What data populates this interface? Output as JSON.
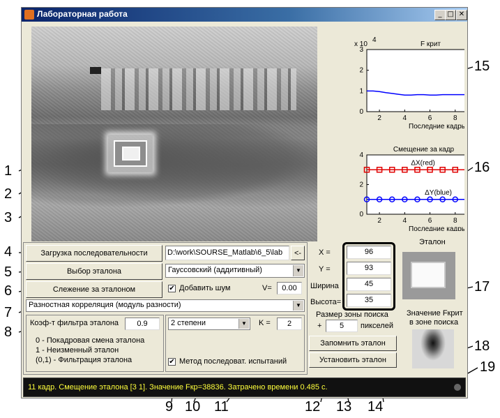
{
  "window": {
    "title": "Лабораторная работа",
    "min": "_",
    "max": "□",
    "close": "✕"
  },
  "buttons": {
    "load_sequence": "Загрузка последовательности",
    "select_template": "Выбор эталона",
    "track_template": "Слежение за эталоном",
    "remember_template": "Запомнить эталон",
    "set_template": "Установить эталон",
    "small_arrow": "<-"
  },
  "path_field": "D:\\work\\SOURSE_Matlab\\6_5\\lab",
  "noise": {
    "type_selected": "Гауссовский (аддитивный)",
    "add_noise_label": "Добавить шум",
    "add_noise_checked": true,
    "v_label": "V=",
    "v_value": "0.00"
  },
  "method_selected": "Разностная корреляция (модуль разности)",
  "filter": {
    "coef_label": "Коэф-т фильтра эталона",
    "coef_value": "0.9",
    "line1": "0   -  Покадровая смена эталона",
    "line2": "1   -     Неизменный эталон",
    "line3": "(0,1) - Фильтрация эталона"
  },
  "degree": {
    "selected": "2 степени",
    "k_label": "K =",
    "k_value": "2",
    "seq_test_label": "Метод последоват. испытаний",
    "seq_test_checked": true
  },
  "coords": {
    "x_label": "X =",
    "x_value": "96",
    "y_label": "Y =",
    "y_value": "93",
    "w_label": "Ширина",
    "w_value": "45",
    "h_label": "Высота=",
    "h_value": "35"
  },
  "search_zone": {
    "title": "Размер зоны поиска",
    "plus": "+",
    "value": "5",
    "unit": "пикселей"
  },
  "template_panel": {
    "title": "Эталон",
    "fcrit_title_1": "Значение Fкрит",
    "fcrit_title_2": "в зоне поиска"
  },
  "status": "11 кадр. Смещение эталона [3 1]. Значение Fкр=38836. Затрачено времени 0.485 с.",
  "callouts": {
    "left": [
      "1",
      "2",
      "3",
      "4",
      "5",
      "6",
      "7",
      "8"
    ],
    "bottom": [
      "9",
      "10",
      "11",
      "12",
      "13",
      "14"
    ],
    "right": [
      "15",
      "16",
      "17",
      "18",
      "19"
    ]
  },
  "chart_data": [
    {
      "type": "line",
      "title": "F крит",
      "xlabel": "Последние кадры",
      "exponent_label": "x 10",
      "exponent_power": "4",
      "xlim": [
        1,
        10
      ],
      "ylim": [
        0,
        3
      ],
      "xticks": [
        "2",
        "4",
        "6",
        "8",
        "10"
      ],
      "yticks": [
        "0",
        "1",
        "2",
        "3"
      ],
      "series": [
        {
          "name": "",
          "color": "#0000ff",
          "x": [
            1,
            1.5,
            2,
            2.5,
            3,
            3.5,
            4,
            4.5,
            5,
            5.5,
            6,
            6.5,
            7,
            7.5,
            8,
            8.5,
            9,
            9.5,
            10
          ],
          "y": [
            1.0,
            1.0,
            0.97,
            0.92,
            0.88,
            0.84,
            0.8,
            0.8,
            0.82,
            0.82,
            0.8,
            0.8,
            0.82,
            0.82,
            0.82,
            0.82,
            0.82,
            0.82,
            0.82
          ]
        }
      ]
    },
    {
      "type": "line",
      "title": "Смещение за кадр",
      "xlabel": "Последние кадры",
      "xlim": [
        1,
        10
      ],
      "ylim": [
        0,
        4
      ],
      "xticks": [
        "2",
        "4",
        "6",
        "8",
        "10"
      ],
      "yticks": [
        "0",
        "2",
        "4"
      ],
      "series": [
        {
          "name": "ΔX(red)",
          "color": "#e00000",
          "marker": "square",
          "x": [
            1,
            2,
            3,
            4,
            5,
            6,
            7,
            8,
            9,
            10
          ],
          "y": [
            3,
            3,
            3,
            3,
            3,
            3,
            3,
            3,
            3,
            3
          ]
        },
        {
          "name": "ΔY(blue)",
          "color": "#0000ff",
          "marker": "circle",
          "x": [
            1,
            2,
            3,
            4,
            5,
            6,
            7,
            8,
            9,
            10
          ],
          "y": [
            1,
            1,
            1,
            1,
            1,
            1,
            1,
            1,
            1,
            1
          ]
        }
      ]
    }
  ]
}
